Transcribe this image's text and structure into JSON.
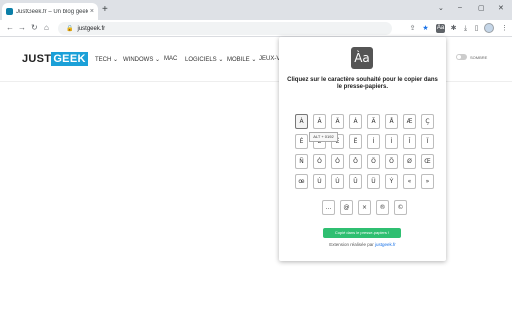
{
  "browser": {
    "tab_title": "JustGeek.fr – Un blog geek et hi...",
    "tab_close": "×",
    "new_tab": "+",
    "window_controls": {
      "chevron": "⌄",
      "minimize": "–",
      "maximize": "▢",
      "close": "✕"
    },
    "nav": {
      "back": "←",
      "forward": "→",
      "reload": "↻",
      "home": "⌂"
    },
    "url": "justgeek.fr",
    "lock_icon": "🔒",
    "extensions": {
      "share": "⇪",
      "star": "★",
      "special_chars": "Àa",
      "puzzle": "✱",
      "download": "⤓",
      "sidebar": "▯",
      "badge": "ON",
      "menu": "⋮"
    }
  },
  "site": {
    "logo_just": "JUST",
    "logo_geek": "GEEK",
    "menu": [
      "TECH ⌄",
      "WINDOWS ⌄",
      "MAC",
      "LOGICIELS ⌄",
      "MOBILE ⌄",
      "JEUX-V"
    ],
    "dark_mode_label": "SOMBRE"
  },
  "popup": {
    "icon_text": "Àa",
    "instruction": "Cliquez sur le caractère souhaité pour le copier dans le presse-papiers.",
    "rows": [
      [
        "À",
        "Â",
        "Ä",
        "Á",
        "Ã",
        "Å",
        "Æ",
        "Ç"
      ],
      [
        "É",
        "È",
        "Ê",
        "Ë",
        "Í",
        "Ì",
        "Î",
        "Ï"
      ],
      [
        "Ñ",
        "Ó",
        "Ò",
        "Ô",
        "Ö",
        "Õ",
        "Ø",
        "Œ"
      ],
      [
        "œ",
        "Ú",
        "Ù",
        "Û",
        "Ü",
        "Ý",
        "«",
        "»"
      ],
      [
        "…",
        "@",
        "×",
        "®",
        "©"
      ]
    ],
    "tooltip": "ALT + 0192",
    "copied_label": "Copié dans le presse-papiers !",
    "credit_prefix": "Extension réalisée par ",
    "credit_link": "justgeek.fr"
  }
}
